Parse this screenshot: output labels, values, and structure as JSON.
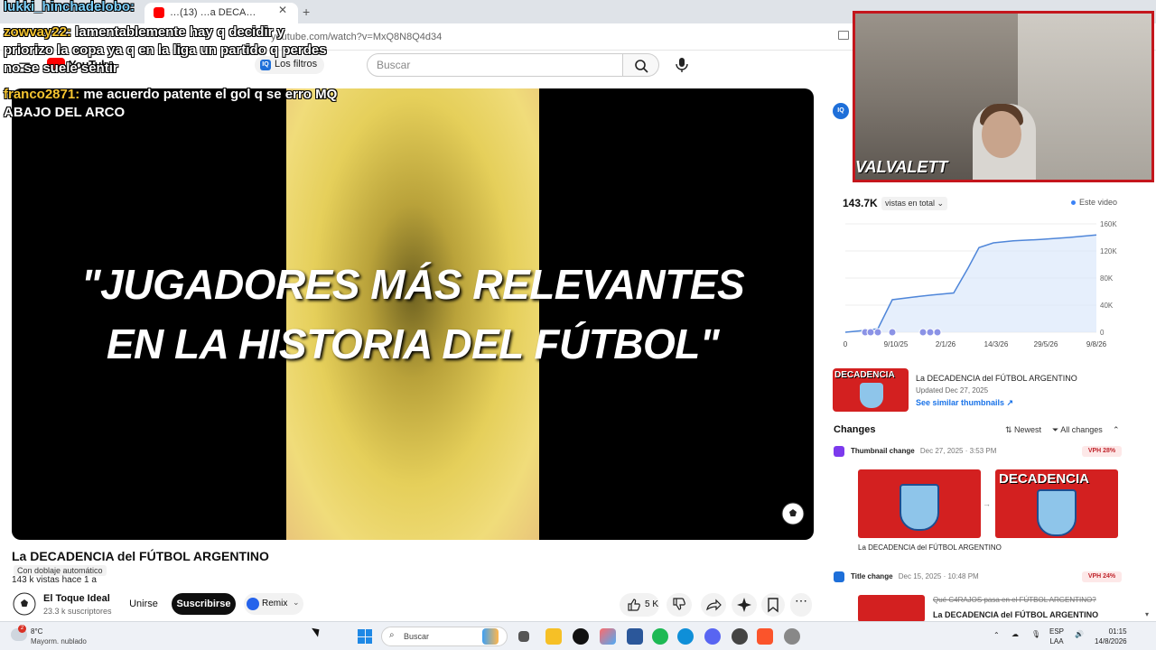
{
  "browser": {
    "tab_title": "…(13) …a DECA…",
    "url": "youtube.com/watch?v=MxQ8N8Q4d34"
  },
  "header": {
    "logo_text": "YouTube",
    "logo_region": "AR",
    "filter_pill": "Los filtros",
    "search_placeholder": "Buscar"
  },
  "chat": [
    {
      "user": "lukki_hinchadelobo:",
      "text": "",
      "color": "#7fd3ff"
    },
    {
      "user": "zowvay22:",
      "text": "lamentablemente hay q decidir y priorizo la copa ya q en la liga un partido q perdes no se suele sentir",
      "color": "#f4c430"
    },
    {
      "user": "franco2871:",
      "text": "me acuerdo patente el gol q se erro MQ ABAJO DEL ARCO",
      "color": "#f4c430"
    }
  ],
  "video": {
    "overlay_line1": "\"JUGADORES MÁS RELEVANTES",
    "overlay_line2": "EN LA HISTORIA DEL FÚTBOL\"",
    "title": "La DECADENCIA del FÚTBOL ARGENTINO",
    "dub_label": "Con doblaje automático",
    "views": "143 k vistas  hace 1 a"
  },
  "channel": {
    "name": "El Toque Ideal",
    "subscribers": "23.3 k suscriptores",
    "join_label": "Unirse",
    "subscribe_label": "Suscribirse",
    "remix_label": "Remix"
  },
  "actions": {
    "likes": "5 K"
  },
  "webcam": {
    "logo": "VALVALETT"
  },
  "analytics": {
    "badge": "IQ",
    "total_views": "143.7K",
    "views_select": "vistas en total",
    "legend": "Este video"
  },
  "chart_data": {
    "type": "area",
    "title": "",
    "x_ticks": [
      "0",
      "9/10/25",
      "2/1/26",
      "14/3/26",
      "29/5/26",
      "9/8/26"
    ],
    "y_ticks": [
      "0",
      "40K",
      "80K",
      "120K",
      "160K"
    ],
    "ylim": [
      0,
      160000
    ],
    "series": [
      {
        "values": [
          0,
          2000,
          5000,
          48000,
          52000,
          55000,
          58000,
          95000,
          125000,
          132000,
          135000,
          137000,
          140000,
          143700
        ]
      }
    ]
  },
  "similar": {
    "thumb_text": "DECADENCIA",
    "title": "La DECADENCIA del FÚTBOL ARGENTINO",
    "updated": "Updated Dec 27, 2025",
    "link": "See similar thumbnails ↗"
  },
  "changes": {
    "heading": "Changes",
    "sort": "Newest",
    "filter": "All changes",
    "items": [
      {
        "type": "Thumbnail change",
        "date": "Dec 27, 2025 · 3:53 PM",
        "vph": "VPH 28%",
        "caption": "La DECADENCIA del FÚTBOL ARGENTINO",
        "new_thumb_text": "DECADENCIA"
      },
      {
        "type": "Title change",
        "date": "Dec 15, 2025 · 10:48 PM",
        "vph": "VPH 24%",
        "old_title": "Qué C4RAJOS pasa en el FÚTBOL ARGENTINO?",
        "new_title": "La DECADENCIA del FÚTBOL ARGENTINO"
      }
    ]
  },
  "taskbar": {
    "weather_temp": "8°C",
    "weather_desc": "Mayorm. nublado",
    "weather_badge": "2",
    "search_label": "Buscar",
    "lang": "ESP",
    "layout": "LAA",
    "time": "01:15",
    "date": "14/8/2026"
  }
}
